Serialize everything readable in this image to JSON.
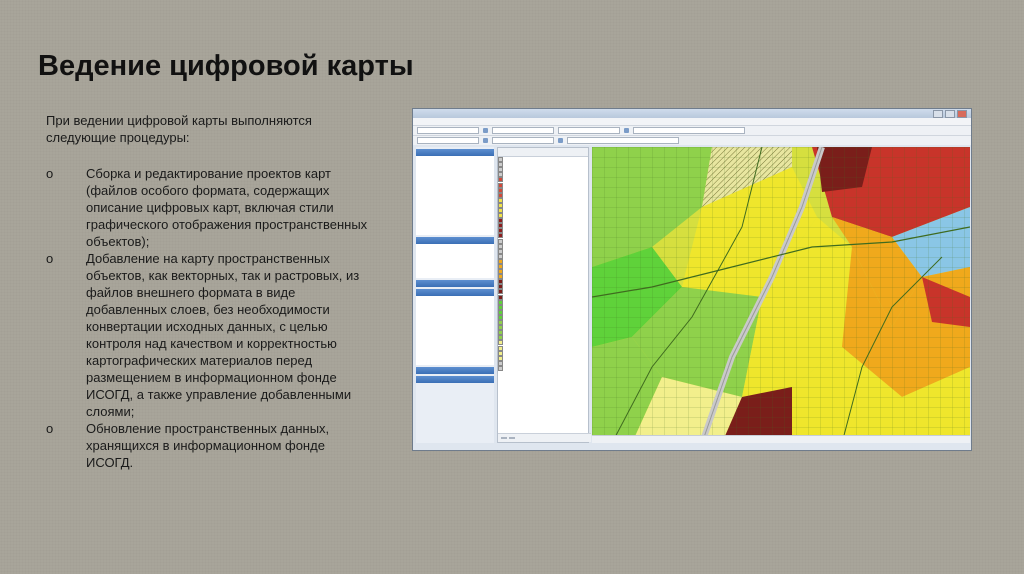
{
  "slide": {
    "title": "Ведение цифровой карты",
    "intro": "При ведении цифровой карты выполняются следующие процедуры:",
    "bullet_marker": "o",
    "bullets": [
      "Сборка и редактирование проектов карт (файлов особого формата, содержащих описание цифровых карт, включая стили графического отображения пространственных объектов);",
      "Добавление на карту пространственных объектов, как векторных, так и растровых, из файлов внешнего формата в виде добавленных слоев, без необходимости конвертации исходных данных, с целью контроля над качеством и корректностью картографических материалов перед размещением в информационном фонде ИСОГД, а также управление добавленными слоями;",
      "Обновление пространственных данных, хранящихся в информационном фонде ИСОГД."
    ]
  },
  "screenshot": {
    "map_colors": {
      "base": "#d6df3f",
      "yellow": "#efe62c",
      "light_yellow": "#f2ef8c",
      "green": "#8fd14b",
      "bright_green": "#5fd23a",
      "orange": "#f0a91c",
      "red": "#c8342a",
      "dark_red": "#7a1e1a",
      "water": "#8ac6e6",
      "road": "#c9c9c9",
      "outline": "#3f6b1f"
    }
  }
}
